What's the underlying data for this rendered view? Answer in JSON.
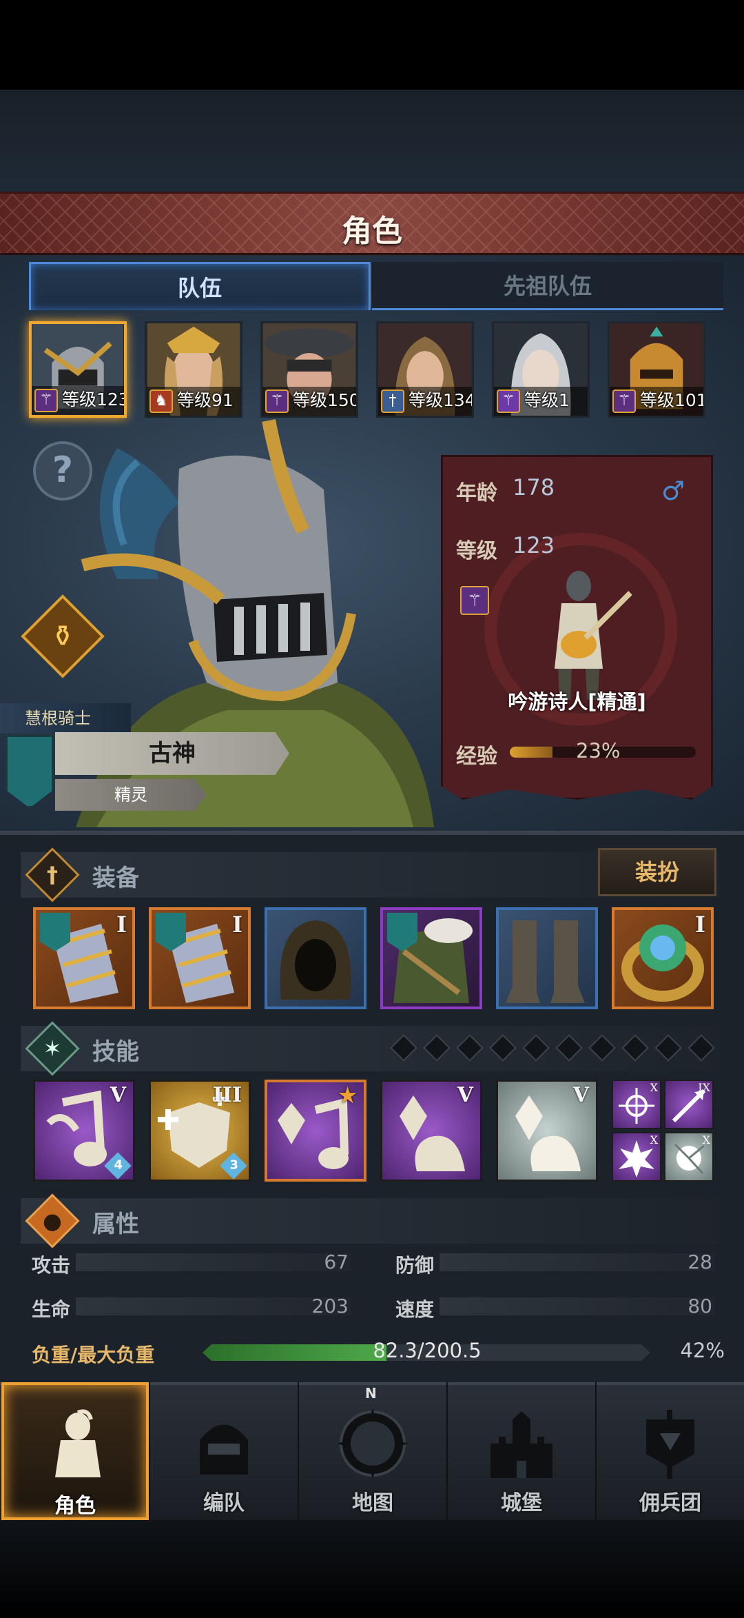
{
  "header": {
    "title": "角色"
  },
  "tabs": [
    {
      "label": "队伍",
      "active": true
    },
    {
      "label": "先祖队伍",
      "active": false
    }
  ],
  "party": [
    {
      "level_text": "等级123",
      "class_icon": "staff-icon",
      "selected": true
    },
    {
      "level_text": "等级91",
      "class_icon": "horse-icon",
      "selected": false
    },
    {
      "level_text": "等级150",
      "class_icon": "staff-icon",
      "selected": false
    },
    {
      "level_text": "等级134",
      "class_icon": "sword-icon",
      "selected": false
    },
    {
      "level_text": "等级1",
      "class_icon": "staff-icon",
      "selected": false
    },
    {
      "level_text": "等级101",
      "class_icon": "staff-icon",
      "selected": false
    }
  ],
  "character": {
    "class_name": "慧根骑士",
    "name": "古神",
    "race": "精灵",
    "age_label": "年龄",
    "age": "178",
    "gender_symbol": "♂",
    "level_label": "等级",
    "level": "123",
    "profession": "吟游诗人[精通]",
    "exp_label": "经验",
    "exp_percent_text": "23%",
    "exp_fraction": 0.23
  },
  "equipment": {
    "title": "装备",
    "dress_button": "装扮",
    "slots": [
      {
        "item": "ornate-bracer",
        "rank": "I",
        "rarity": "orange",
        "crest": true
      },
      {
        "item": "ornate-bracer",
        "rank": "I",
        "rarity": "orange",
        "crest": true
      },
      {
        "item": "green-hood",
        "rank": "",
        "rarity": "blue",
        "crest": false
      },
      {
        "item": "fur-cloak-armor",
        "rank": "",
        "rarity": "purple",
        "crest": true
      },
      {
        "item": "cloth-boots",
        "rank": "",
        "rarity": "blue",
        "crest": false
      },
      {
        "item": "jade-ring",
        "rank": "I",
        "rarity": "orange",
        "crest": false
      }
    ]
  },
  "skills": {
    "title": "技能",
    "slot_count": 10,
    "items": [
      {
        "icon": "music-note-skill",
        "rank": "V",
        "gem": "4",
        "color": "purple",
        "selected": false
      },
      {
        "icon": "holy-shield-skill",
        "rank": "III",
        "gem": "3",
        "color": "gold",
        "selected": false
      },
      {
        "icon": "crystal-note-skill",
        "rank": "★",
        "gem": "",
        "color": "purple",
        "selected": true
      },
      {
        "icon": "crystal-hand-skill",
        "rank": "V",
        "gem": "",
        "color": "purple",
        "selected": false
      },
      {
        "icon": "crystal-hand-skill",
        "rank": "V",
        "gem": "",
        "color": "white",
        "selected": false
      }
    ],
    "mini": [
      {
        "icon": "target-burst-icon",
        "rank": "X",
        "color": "purple"
      },
      {
        "icon": "arrow-strike-icon",
        "rank": "IX",
        "color": "purple"
      },
      {
        "icon": "explosion-icon",
        "rank": "X",
        "color": "purple"
      },
      {
        "icon": "shatter-icon",
        "rank": "X",
        "color": "white"
      }
    ]
  },
  "attributes": {
    "title": "属性",
    "rows": [
      {
        "label": "攻击",
        "value": "67"
      },
      {
        "label": "防御",
        "value": "28"
      },
      {
        "label": "生命",
        "value": "203"
      },
      {
        "label": "速度",
        "value": "80"
      }
    ],
    "load_label": "负重/最大负重",
    "load_text": "82.3/200.5",
    "load_percent": "42%",
    "load_fraction": 0.41
  },
  "nav": [
    {
      "label": "角色",
      "icon": "knight-icon",
      "active": true
    },
    {
      "label": "编队",
      "icon": "helmet-icon",
      "active": false
    },
    {
      "label": "地图",
      "icon": "compass-map-icon",
      "active": false,
      "compass_letter": "N"
    },
    {
      "label": "城堡",
      "icon": "castle-icon",
      "active": false
    },
    {
      "label": "佣兵团",
      "icon": "banner-icon",
      "active": false
    }
  ],
  "colors": {
    "accent_gold": "#f0a030",
    "tab_blue": "#4f8ad8",
    "exp_fill": "#e0a030",
    "load_fill": "#4ea84a"
  }
}
